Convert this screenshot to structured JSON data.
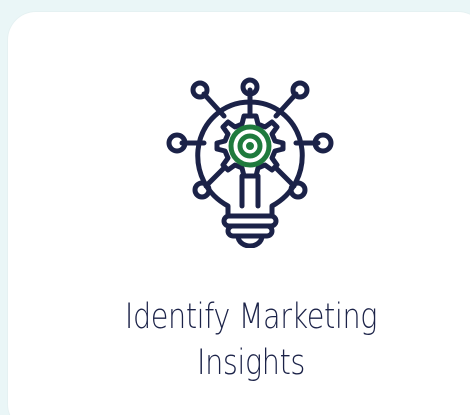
{
  "card": {
    "title_line1": "Identify Marketing",
    "title_line2": "Insights",
    "icon": "lightbulb-gear-target-icon"
  },
  "colors": {
    "page_background": "#eaf6f7",
    "card_background": "#ffffff",
    "text": "#1b2248",
    "icon_stroke": "#1b2248",
    "icon_accent": "#1f7a3d"
  }
}
